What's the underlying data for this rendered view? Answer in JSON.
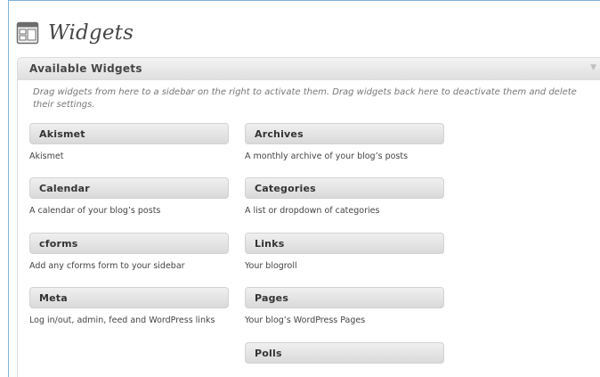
{
  "header": {
    "title": "Widgets",
    "icon": "widgets-icon"
  },
  "panel": {
    "title": "Available Widgets",
    "toggle_icon": "triangle-down-icon",
    "description": "Drag widgets from here to a sidebar on the right to activate them. Drag widgets back here to deactivate them and delete their settings."
  },
  "widgets": [
    {
      "title": "Akismet",
      "description": "Akismet"
    },
    {
      "title": "Archives",
      "description": "A monthly archive of your blog’s posts"
    },
    {
      "title": "Calendar",
      "description": "A calendar of your blog’s posts"
    },
    {
      "title": "Categories",
      "description": "A list or dropdown of categories"
    },
    {
      "title": "cforms",
      "description": "Add any cforms form to your sidebar"
    },
    {
      "title": "Links",
      "description": "Your blogroll"
    },
    {
      "title": "Meta",
      "description": "Log in/out, admin, feed and WordPress links"
    },
    {
      "title": "Pages",
      "description": "Your blog’s WordPress Pages"
    },
    {
      "title": "Polls",
      "description": ""
    }
  ],
  "colors": {
    "frame": "#7fb0d9",
    "title_text": "#464646"
  }
}
